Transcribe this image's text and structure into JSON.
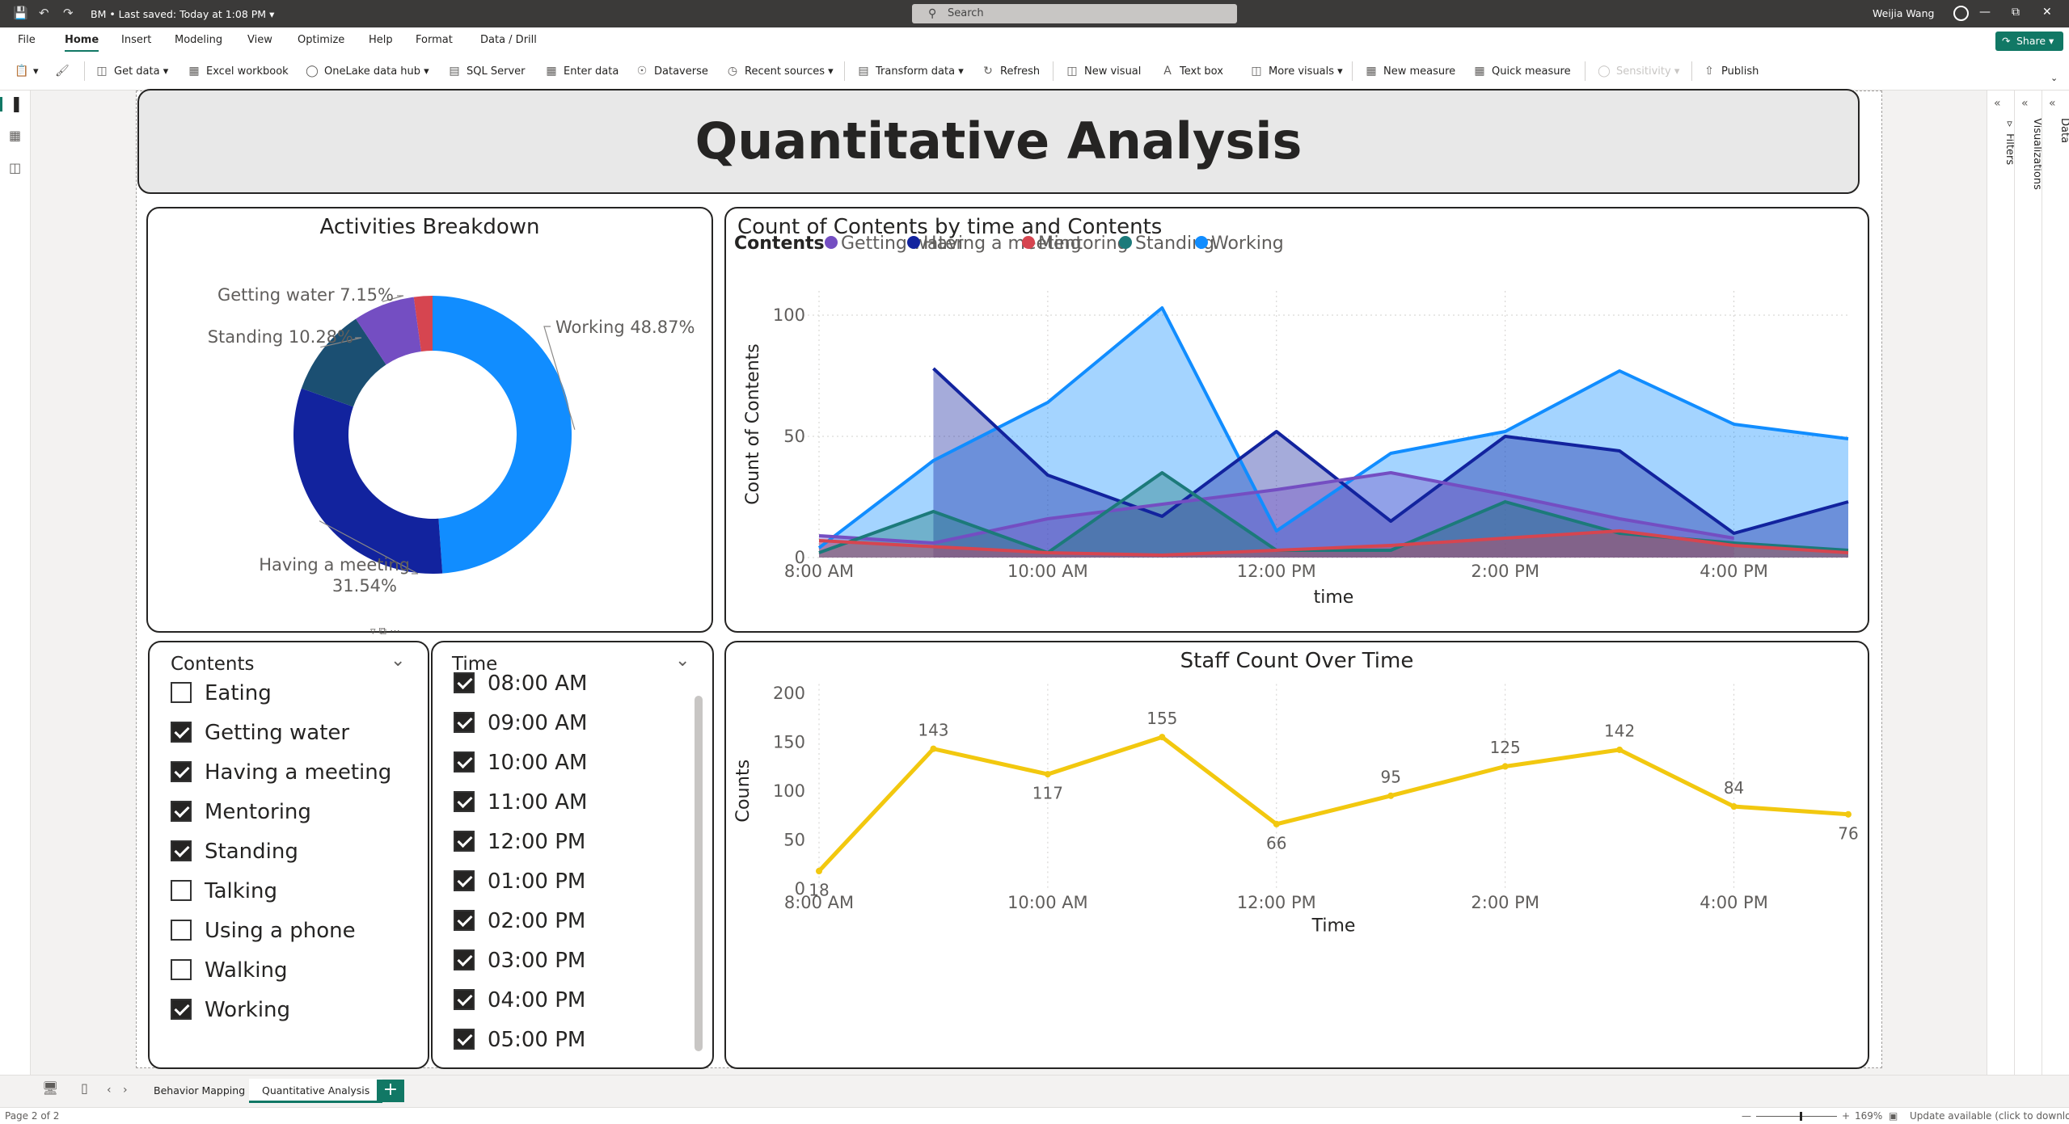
{
  "titlebar": {
    "doc_title": "BM • Last saved: Today at 1:08 PM",
    "search_placeholder": "Search",
    "user_name": "Weijia Wang"
  },
  "ribbon": {
    "tabs": [
      "File",
      "Home",
      "Insert",
      "Modeling",
      "View",
      "Optimize",
      "Help",
      "Format",
      "Data / Drill"
    ],
    "active_tab": "Home",
    "share_label": "Share",
    "buttons": {
      "get_data": "Get data",
      "excel_workbook": "Excel workbook",
      "onelake": "OneLake data hub",
      "sql_server": "SQL Server",
      "enter_data": "Enter data",
      "dataverse": "Dataverse",
      "recent_sources": "Recent sources",
      "transform_data": "Transform data",
      "refresh": "Refresh",
      "new_visual": "New visual",
      "text_box": "Text box",
      "more_visuals": "More visuals",
      "new_measure": "New measure",
      "quick_measure": "Quick measure",
      "sensitivity": "Sensitivity",
      "publish": "Publish"
    }
  },
  "panes": {
    "filters": "Filters",
    "visualizations": "Visualizations",
    "data": "Data"
  },
  "report": {
    "title": "Quantitative Analysis",
    "donut_title": "Activities Breakdown",
    "area_title": "Count of Contents by time and Contents",
    "line_title": "Staff Count Over Time"
  },
  "slicer_contents": {
    "header": "Contents",
    "items": [
      {
        "label": "Eating",
        "checked": false
      },
      {
        "label": "Getting water",
        "checked": true
      },
      {
        "label": "Having a meeting",
        "checked": true
      },
      {
        "label": "Mentoring",
        "checked": true
      },
      {
        "label": "Standing",
        "checked": true
      },
      {
        "label": "Talking",
        "checked": false
      },
      {
        "label": "Using a phone",
        "checked": false
      },
      {
        "label": "Walking",
        "checked": false
      },
      {
        "label": "Working",
        "checked": true
      }
    ]
  },
  "slicer_time": {
    "header": "Time",
    "items": [
      {
        "label": "08:00 AM",
        "checked": true
      },
      {
        "label": "09:00 AM",
        "checked": true
      },
      {
        "label": "10:00 AM",
        "checked": true
      },
      {
        "label": "11:00 AM",
        "checked": true
      },
      {
        "label": "12:00 PM",
        "checked": true
      },
      {
        "label": "01:00 PM",
        "checked": true
      },
      {
        "label": "02:00 PM",
        "checked": true
      },
      {
        "label": "03:00 PM",
        "checked": true
      },
      {
        "label": "04:00 PM",
        "checked": true
      },
      {
        "label": "05:00 PM",
        "checked": true
      }
    ]
  },
  "pages": {
    "tabs": [
      "Behavior Mapping",
      "Quantitative Analysis"
    ],
    "active": "Quantitative Analysis"
  },
  "status": {
    "page": "Page 2 of 2",
    "zoom": "169%",
    "update": "Update available (click to download)"
  },
  "colors": {
    "accent": "#117865",
    "getting_water": "#744EC2",
    "having_a_meeting": "#12239E",
    "mentoring": "#D64550",
    "standing": "#1C7A7A",
    "working": "#118DFF",
    "staff_line": "#F2C80F"
  },
  "chart_data": [
    {
      "type": "pie",
      "title": "Activities Breakdown",
      "donut": true,
      "slices": [
        {
          "label": "Working",
          "value": 48.87,
          "color": "#118DFF"
        },
        {
          "label": "Having a meeting",
          "value": 31.54,
          "color": "#12239E"
        },
        {
          "label": "Standing",
          "value": 10.28,
          "color": "#1B4F72"
        },
        {
          "label": "Getting water",
          "value": 7.15,
          "color": "#744EC2"
        },
        {
          "label": "Mentoring",
          "value": 2.16,
          "color": "#D64550"
        }
      ],
      "data_labels": [
        {
          "label": "Working",
          "text": "Working 48.87%"
        },
        {
          "label": "Having a meeting",
          "text": "Having a meeting",
          "text2": "31.54%"
        },
        {
          "label": "Standing",
          "text": "Standing 10.28%"
        },
        {
          "label": "Getting water",
          "text": "Getting water 7.15%"
        }
      ]
    },
    {
      "type": "area",
      "title": "Count of Contents by time and Contents",
      "xlabel": "time",
      "ylabel": "Count of Contents",
      "legend_title": "Contents",
      "legend_position": "top-left",
      "x": [
        "8:00 AM",
        "9:00 AM",
        "10:00 AM",
        "11:00 AM",
        "12:00 PM",
        "1:00 PM",
        "2:00 PM",
        "3:00 PM",
        "4:00 PM",
        "4:30 PM"
      ],
      "x_tick_labels": [
        "8:00 AM",
        "10:00 AM",
        "12:00 PM",
        "2:00 PM",
        "4:00 PM"
      ],
      "ylim": [
        0,
        110
      ],
      "y_ticks": [
        0,
        50,
        100
      ],
      "grid": true,
      "series": [
        {
          "name": "Getting water",
          "color": "#744EC2",
          "values": [
            9,
            6,
            16,
            22,
            28,
            35,
            26,
            16,
            8,
            null
          ]
        },
        {
          "name": "Having a meeting",
          "color": "#12239E",
          "values": [
            null,
            78,
            34,
            17,
            52,
            15,
            50,
            44,
            10,
            23
          ]
        },
        {
          "name": "Mentoring",
          "color": "#D64550",
          "values": [
            7,
            null,
            2,
            1,
            3,
            5,
            8,
            11,
            5,
            2
          ]
        },
        {
          "name": "Standing",
          "color": "#1C7A7A",
          "values": [
            2,
            19,
            2,
            35,
            3,
            3,
            23,
            10,
            6,
            3
          ]
        },
        {
          "name": "Working",
          "color": "#118DFF",
          "values": [
            4,
            40,
            64,
            103,
            11,
            43,
            52,
            77,
            55,
            49
          ]
        }
      ]
    },
    {
      "type": "line",
      "title": "Staff Count Over Time",
      "xlabel": "Time",
      "ylabel": "Counts",
      "x": [
        "8:00 AM",
        "9:00 AM",
        "10:00 AM",
        "11:00 AM",
        "12:00 PM",
        "1:00 PM",
        "2:00 PM",
        "3:00 PM",
        "4:00 PM",
        "4:30 PM"
      ],
      "x_tick_labels": [
        "8:00 AM",
        "10:00 AM",
        "12:00 PM",
        "2:00 PM",
        "4:00 PM"
      ],
      "ylim": [
        0,
        200
      ],
      "y_ticks": [
        0,
        50,
        100,
        150,
        200
      ],
      "grid": true,
      "series": [
        {
          "color": "#F2C80F",
          "values": [
            18,
            143,
            117,
            155,
            66,
            95,
            125,
            142,
            84,
            76
          ]
        }
      ],
      "label_below": [
        true,
        false,
        true,
        false,
        true,
        false,
        false,
        false,
        false,
        true
      ]
    }
  ]
}
